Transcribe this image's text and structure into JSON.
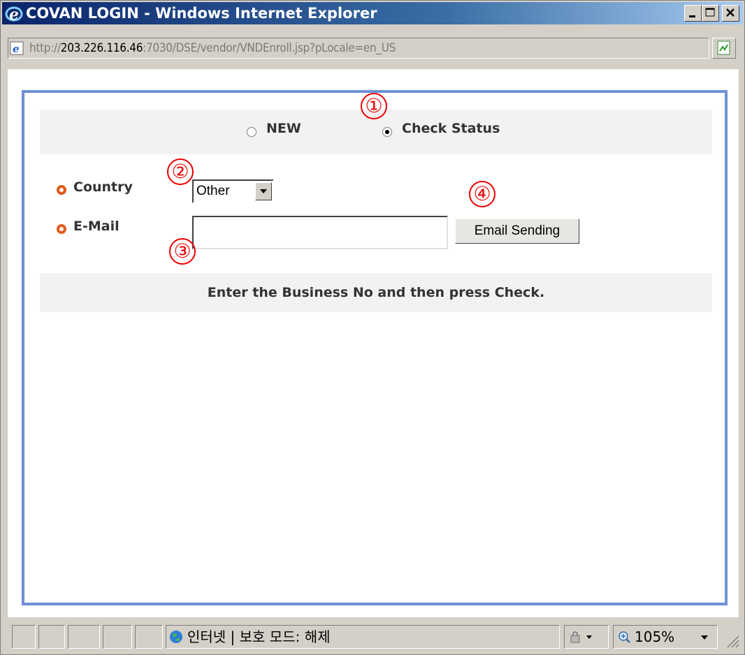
{
  "window": {
    "title": "COVAN LOGIN - Windows Internet Explorer",
    "controls": {
      "minimize": "_",
      "maximize": "□",
      "close": "×"
    }
  },
  "address": {
    "scheme": "http://",
    "host": "203.226.116.46",
    "path": ":7030/DSE/vendor/VNDEnroll.jsp?pLocale=en_US"
  },
  "form": {
    "mode_options": [
      {
        "label": "NEW",
        "selected": false
      },
      {
        "label": "Check Status",
        "selected": true
      }
    ],
    "country": {
      "label": "Country",
      "value": "Other"
    },
    "email": {
      "label": "E-Mail",
      "value": ""
    },
    "send_button": "Email Sending",
    "message": "Enter the Business No and then press Check."
  },
  "callouts": [
    "①",
    "②",
    "③",
    "④"
  ],
  "status": {
    "zone": "인터넷 | 보호 모드: 해제",
    "zoom": "105%"
  },
  "colors": {
    "frame_border": "#6f8fd6",
    "bullet": "#e05a1e",
    "callout": "#ee0000"
  }
}
